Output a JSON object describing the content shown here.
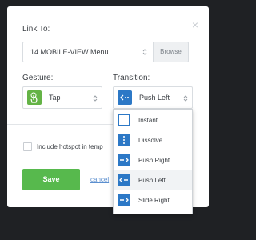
{
  "dialog": {
    "close_glyph": "×",
    "link_to_label": "Link To:",
    "link_value": "14 MOBILE-VIEW Menu",
    "browse_label": "Browse",
    "gesture_label": "Gesture:",
    "gesture_value": "Tap",
    "transition_label": "Transition:",
    "transition_value": "Push Left",
    "hotspot_checkbox_label": "Include hotspot in temp",
    "save_label": "Save",
    "cancel_label": "cancel"
  },
  "transition_options": [
    {
      "label": "Instant",
      "icon": "instant-icon"
    },
    {
      "label": "Dissolve",
      "icon": "dissolve-icon"
    },
    {
      "label": "Push Right",
      "icon": "push-right-icon"
    },
    {
      "label": "Push Left",
      "icon": "push-left-icon",
      "selected": true
    },
    {
      "label": "Slide Right",
      "icon": "slide-right-icon"
    }
  ],
  "colors": {
    "save_green": "#57b94d",
    "gesture_green": "#64b346",
    "transition_blue": "#2c78c6",
    "backdrop": "#1f2124"
  }
}
